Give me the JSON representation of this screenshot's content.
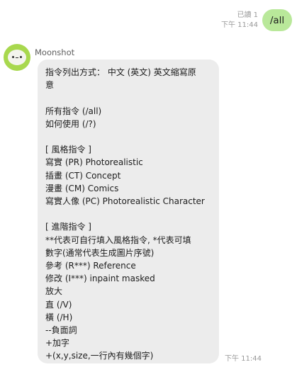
{
  "outgoing": {
    "read_receipt": "已讀 1",
    "time": "下午 11:44",
    "text": "/all"
  },
  "incoming": {
    "sender": "Moonshot",
    "time": "下午 11:44",
    "lines": [
      "指令列出方式： 中文 (英文) 英文縮寫原",
      "意",
      "",
      "所有指令 (/all)",
      "如何使用 (/?)",
      "",
      "[ 風格指令 ]",
      "寫實 (PR) Photorealistic",
      "插畫 (CT) Concept",
      "漫畫 (CM) Comics",
      "寫實人像 (PC) Photorealistic Character",
      "",
      "[ 進階指令 ]",
      "**代表可自行填入風格指令, *代表可填",
      "數字(通常代表生成圖片序號)",
      "參考 (R***) Reference",
      "修改 (I***) inpaint masked",
      "放大",
      "直 (/V)",
      "橫 (/H)",
      "--負面詞",
      "+加字",
      "+(x,y,size,一行內有幾個字)"
    ]
  },
  "colors": {
    "outgoing_bubble": "#b9e89a",
    "incoming_bubble": "#ececec",
    "avatar": "#a8d84e"
  },
  "icons": {
    "avatar": "moonshot-avatar-icon"
  }
}
